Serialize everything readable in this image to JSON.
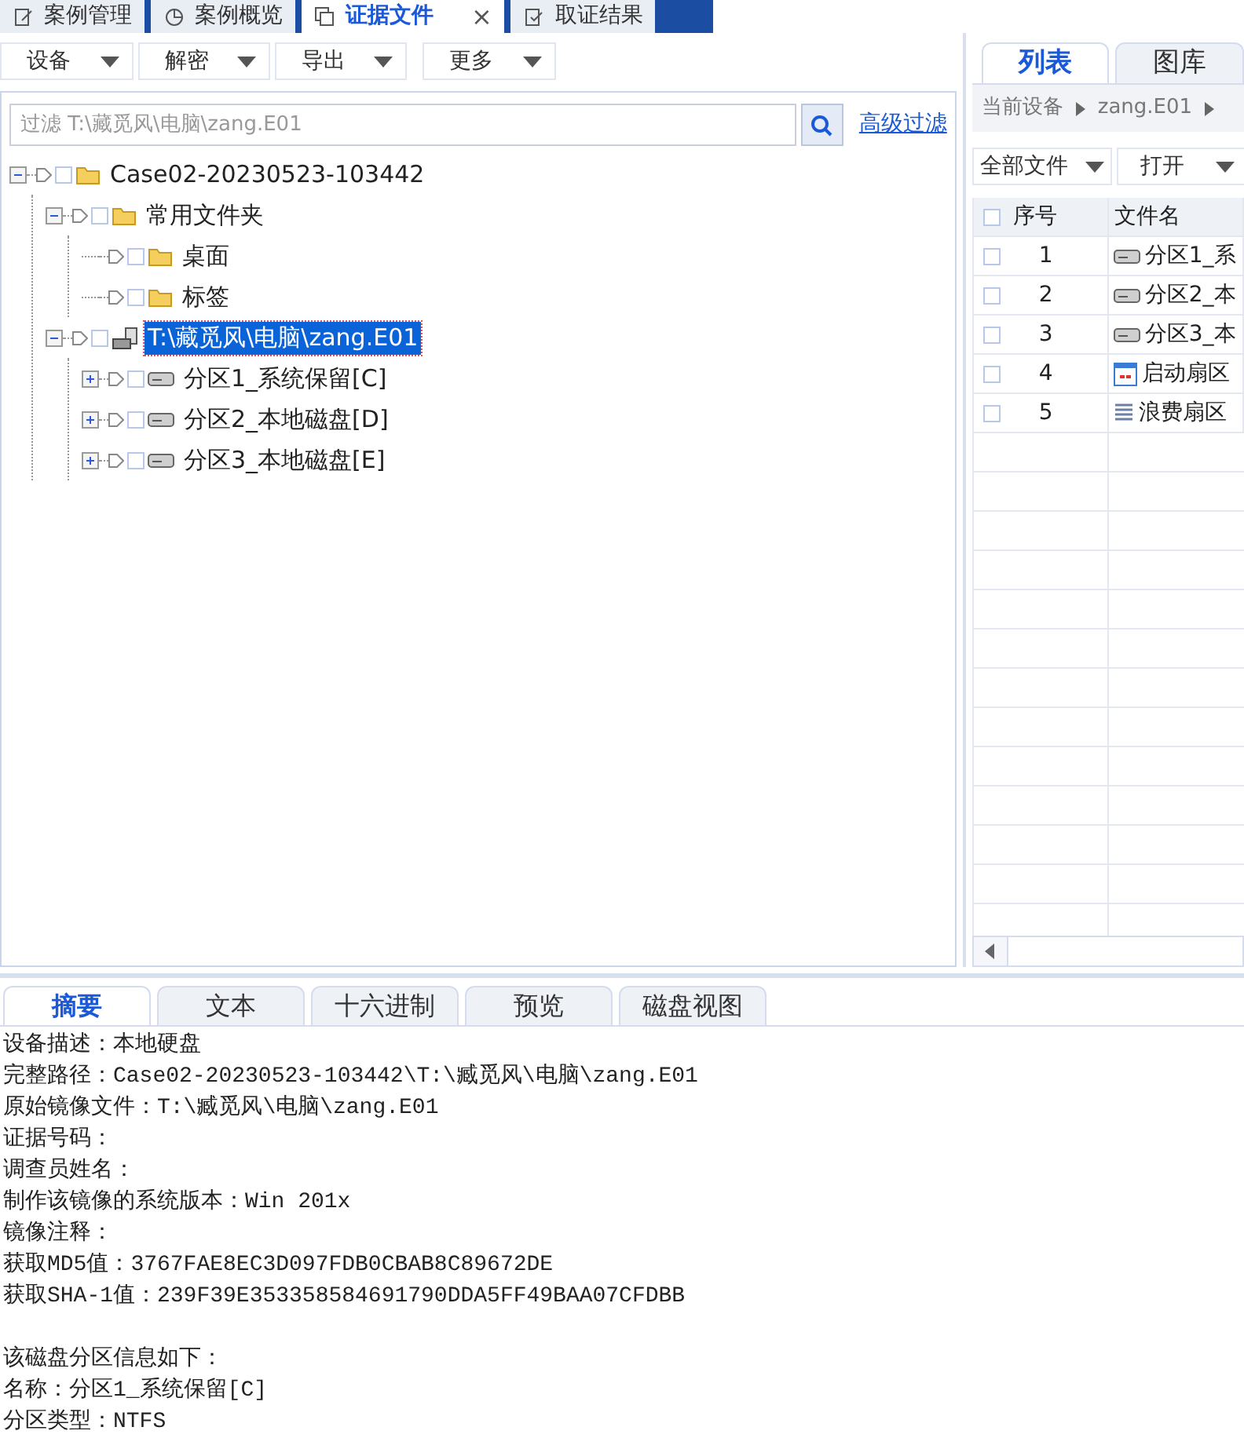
{
  "top_tabs": [
    {
      "label": "案例管理",
      "selected": false
    },
    {
      "label": "案例概览",
      "selected": false
    },
    {
      "label": "证据文件",
      "selected": true,
      "close": "×"
    },
    {
      "label": "取证结果",
      "selected": false
    }
  ],
  "toolbar": [
    {
      "label": "设备"
    },
    {
      "label": "解密"
    },
    {
      "label": "导出"
    },
    {
      "label": "更多"
    }
  ],
  "filter": {
    "placeholder": "过滤 T:\\藏觅风\\电脑\\zang.E01",
    "advanced": "高级过滤"
  },
  "tree": [
    {
      "label": "Case02-20230523-103442",
      "kind": "folder",
      "expanded": true,
      "checked": false,
      "selected": false,
      "children": [
        {
          "label": "常用文件夹",
          "kind": "folder",
          "expanded": true,
          "checked": false,
          "selected": false,
          "children": [
            {
              "label": "桌面",
              "kind": "folder",
              "checked": false,
              "selected": false
            },
            {
              "label": "标签",
              "kind": "folder",
              "checked": false,
              "selected": false
            }
          ]
        },
        {
          "label": "T:\\藏觅风\\电脑\\zang.E01",
          "kind": "device",
          "expanded": true,
          "checked": false,
          "selected": true,
          "children": [
            {
              "label": "分区1_系统保留[C]",
              "kind": "disk",
              "expanded": false,
              "checked": false,
              "selected": false
            },
            {
              "label": "分区2_本地磁盘[D]",
              "kind": "disk",
              "expanded": false,
              "checked": false,
              "selected": false
            },
            {
              "label": "分区3_本地磁盘[E]",
              "kind": "disk",
              "expanded": false,
              "checked": false,
              "selected": false
            }
          ]
        }
      ]
    }
  ],
  "right": {
    "tabs": [
      {
        "label": "列表",
        "selected": true
      },
      {
        "label": "图库",
        "selected": false
      }
    ],
    "breadcrumb": [
      "当前设备",
      "zang.E01"
    ],
    "toolbar": [
      {
        "label": "全部文件"
      },
      {
        "label": "打开"
      }
    ],
    "columns": [
      "序号",
      "文件名"
    ],
    "all_checked": false,
    "rows": [
      {
        "no": "1",
        "name": "分区1_系",
        "kind": "disk",
        "checked": false
      },
      {
        "no": "2",
        "name": "分区2_本",
        "kind": "disk",
        "checked": false
      },
      {
        "no": "3",
        "name": "分区3_本",
        "kind": "disk",
        "checked": false
      },
      {
        "no": "4",
        "name": "启动扇区",
        "kind": "boot",
        "checked": false
      },
      {
        "no": "5",
        "name": "浪费扇区",
        "kind": "slack",
        "checked": false
      }
    ]
  },
  "bottom_tabs": [
    {
      "label": "摘要",
      "selected": true
    },
    {
      "label": "文本",
      "selected": false
    },
    {
      "label": "十六进制",
      "selected": false
    },
    {
      "label": "预览",
      "selected": false
    },
    {
      "label": "磁盘视图",
      "selected": false
    }
  ],
  "summary": [
    [
      "设备描述：本地硬盘",
      "完整路径：Case02-20230523-103442\\T:\\臧觅风\\电脑\\zang.E01",
      "原始镜像文件：T:\\臧觅风\\电脑\\zang.E01",
      "证据号码：",
      "调查员姓名：",
      "制作该镜像的系统版本：Win 201x",
      "镜像注释：",
      "获取MD5值：3767FAE8EC3D097FDB0CBAB8C89672DE",
      "获取SHA-1值：239F39E353358584691790DDA5FF49BAA07CFDBB"
    ],
    [
      "该磁盘分区信息如下：",
      "名称：分区1_系统保留[C]",
      "分区类型：NTFS"
    ]
  ]
}
